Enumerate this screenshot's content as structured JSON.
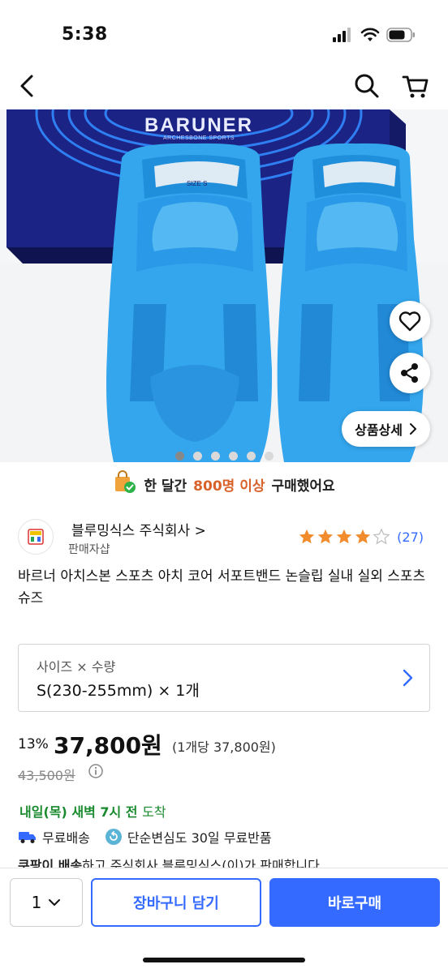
{
  "status_bar": {
    "time": "5:38"
  },
  "product_image": {
    "brand_name": "BARUNER",
    "brand_sub": "ARCHESBONE SPORTS",
    "box_size_label": "SIZE S",
    "carousel_total": 6,
    "carousel_active": 1,
    "detail_button": "상품상세"
  },
  "banner": {
    "prefix": "한 달간",
    "highlight": "800명 이상",
    "suffix": "구매했어요"
  },
  "seller": {
    "name": "블루밍식스 주식회사 >",
    "type": "판매자샵"
  },
  "rating": {
    "stars": 4,
    "max": 5,
    "count": "(27)"
  },
  "product": {
    "title": "바르너 아치스본 스포츠 아치 코어 서포트밴드 논슬립 실내 실외 스포츠슈즈"
  },
  "option": {
    "label": "사이즈 × 수량",
    "value": "S(230-255mm) × 1개"
  },
  "price": {
    "discount": "13%",
    "sale": "37,800원",
    "unit": "(1개당 37,800원)",
    "original": "43,500원"
  },
  "delivery": {
    "date": "내일(목) 새벽 7시 전",
    "suffix": "도착",
    "free_shipping": "무료배송",
    "free_return": "단순변심도 30일 무료반품",
    "rocket_bold": "쿠팡이 배송",
    "rocket_text": "하고 주식회사 블루밍식스(이)가 판매합니다."
  },
  "bottom_bar": {
    "quantity": "1",
    "cart_button": "장바구니 담기",
    "buy_button": "바로구매"
  },
  "colors": {
    "accent": "#346aff",
    "delivery_green": "#1a8a2e",
    "highlight_orange": "#d9622b",
    "star": "#f28b2c",
    "product_blue": "#33a6ee",
    "box_navy": "#1b2385"
  }
}
